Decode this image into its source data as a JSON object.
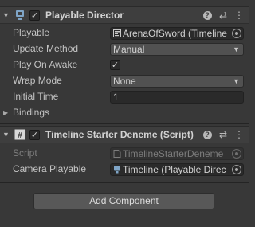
{
  "playable_director": {
    "title": "Playable Director",
    "enabled": true,
    "fields": {
      "playable": {
        "label": "Playable",
        "value": "ArenaOfSword (Timeline"
      },
      "update_method": {
        "label": "Update Method",
        "value": "Manual"
      },
      "play_on_awake": {
        "label": "Play On Awake",
        "checked": true
      },
      "wrap_mode": {
        "label": "Wrap Mode",
        "value": "None"
      },
      "initial_time": {
        "label": "Initial Time",
        "value": "1"
      },
      "bindings": {
        "label": "Bindings"
      }
    },
    "icon": "playable-director-icon"
  },
  "timeline_starter": {
    "title": "Timeline Starter Deneme (Script)",
    "enabled": true,
    "fields": {
      "script": {
        "label": "Script",
        "value": "TimelineStarterDeneme"
      },
      "camera_playable": {
        "label": "Camera Playable",
        "value": "Timeline (Playable Direc"
      }
    },
    "icon": "csharp-script-icon"
  },
  "add_component_label": "Add Component",
  "glyphs": {
    "check": "✓",
    "fold_open": "▼",
    "fold_closed": "▶",
    "dropdown_arrow": "▼",
    "help": "?",
    "settings": "⇄",
    "more": "⋮"
  },
  "colors": {
    "background": "#383838",
    "header": "#3e3e3e",
    "field": "#2a2a2a",
    "text": "#c4c4c4"
  }
}
